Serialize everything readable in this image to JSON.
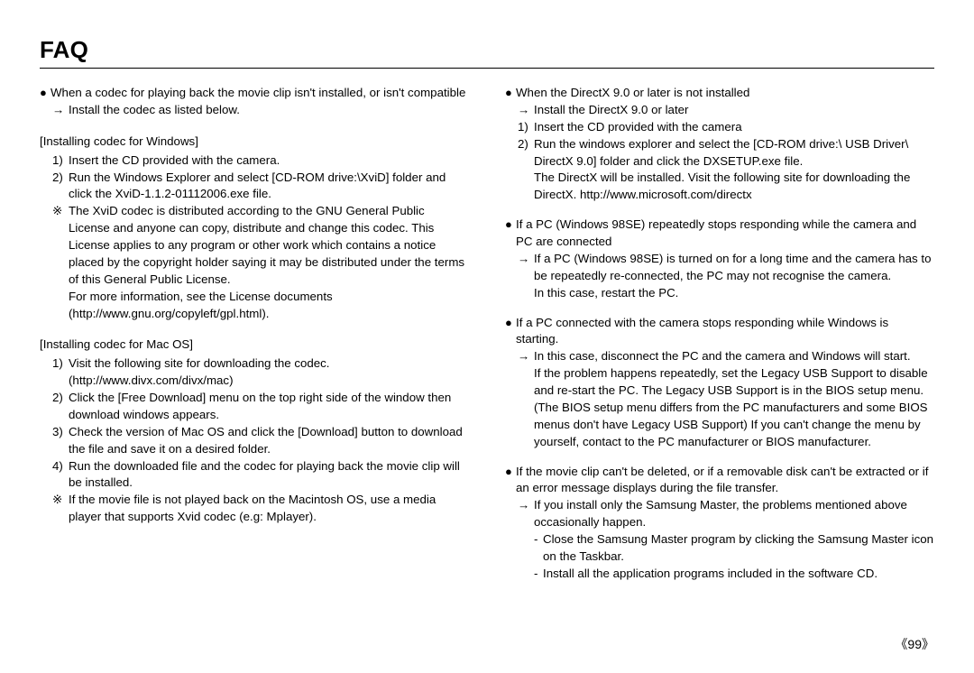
{
  "title": "FAQ",
  "page_number": "《99》",
  "left": {
    "b1": {
      "text": "When a codec for playing back the movie clip isn't installed, or isn't compatible",
      "arrow": "Install the codec as listed below."
    },
    "win": {
      "heading": "[Installing codec for Windows]",
      "i1n": "1)",
      "i1": "Insert the CD provided with the camera.",
      "i2n": "2)",
      "i2": "Run the Windows Explorer and select [CD-ROM drive:\\XviD] folder and click the XviD-1.1.2-01112006.exe file.",
      "note_sym": "※",
      "note": "The XviD codec is distributed according to the GNU General Public License and anyone can copy, distribute and change this codec. This License applies to any program or other work which contains a notice placed by the copyright holder saying it may be distributed under the terms of this General Public License.",
      "note_more": "For more information, see the License documents (http://www.gnu.org/copyleft/gpl.html)."
    },
    "mac": {
      "heading": "[Installing codec for Mac OS]",
      "i1n": "1)",
      "i1": "Visit the following site for downloading the codec. (http://www.divx.com/divx/mac)",
      "i2n": "2)",
      "i2": "Click the [Free Download] menu on the top right side of the window then download windows appears.",
      "i3n": "3)",
      "i3": "Check the version of Mac OS and click the [Download] button to download the file and save it on a desired folder.",
      "i4n": "4)",
      "i4": "Run the downloaded file and the codec for playing back the movie clip will be installed.",
      "note_sym": "※",
      "note": "If the movie file is not played back on the Macintosh OS, use a media player that supports Xvid codec (e.g: Mplayer)."
    }
  },
  "right": {
    "dx": {
      "text": "When the DirectX 9.0 or later is not installed",
      "arrow": "Install the DirectX 9.0 or later",
      "i1n": "1)",
      "i1": "Insert the CD provided with the camera",
      "i2n": "2)",
      "i2": "Run the windows explorer and select the [CD-ROM drive:\\ USB Driver\\ DirectX 9.0] folder and click the DXSETUP.exe file.",
      "i2b": "The DirectX will be installed. Visit the following site for downloading the DirectX. http://www.microsoft.com/directx"
    },
    "pc98": {
      "text": "If a PC (Windows 98SE) repeatedly stops responding while the camera and PC are connected",
      "arrow": "If a PC (Windows 98SE) is turned on for a long time and the camera has to be repeatedly re-connected, the PC may not recognise the camera.",
      "arrow2": "In this case, restart the PC."
    },
    "stop": {
      "text": "If a PC connected with the camera stops responding while Windows is starting.",
      "arrow": "In this case, disconnect the PC and the camera and Windows will start.",
      "cont": "If the problem happens repeatedly, set the Legacy USB Support to disable and re-start the PC. The Legacy USB Support is in the BIOS setup menu. (The BIOS setup menu differs from the PC manufacturers and some BIOS menus don't have Legacy USB Support) If you can't change the menu by yourself, contact to the PC manufacturer or BIOS manufacturer."
    },
    "clip": {
      "text": "If the movie clip can't be deleted, or if a removable disk can't be extracted or if an error message displays during the file transfer.",
      "arrow": "If you install only the Samsung Master, the problems mentioned above occasionally happen.",
      "dash1": "Close the Samsung Master program by clicking the Samsung Master icon on the Taskbar.",
      "dash2": "Install all the application programs included in the software CD."
    }
  }
}
